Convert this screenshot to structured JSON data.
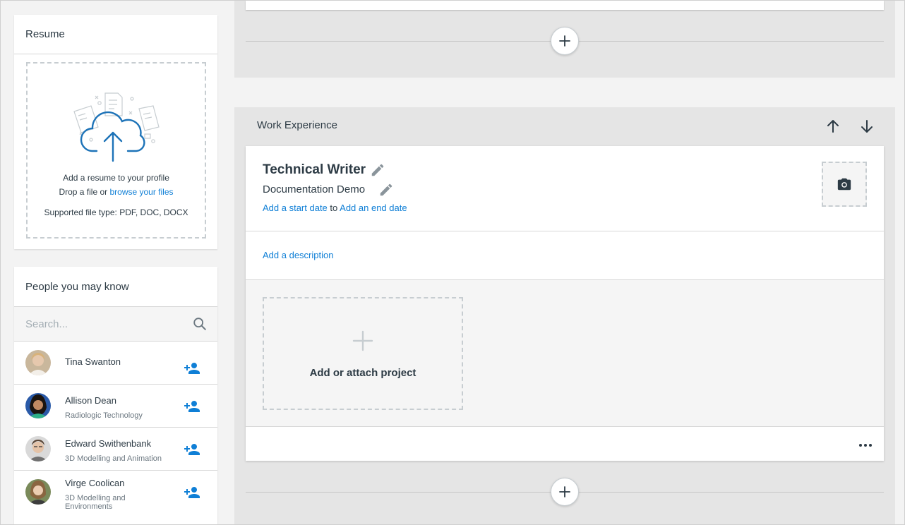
{
  "resume": {
    "title": "Resume",
    "line1": "Add a resume to your profile",
    "line2_prefix": "Drop a file or ",
    "line2_link": "browse your files",
    "line3": "Supported file type: PDF, DOC, DOCX"
  },
  "people": {
    "title": "People you may know",
    "search_placeholder": "Search...",
    "items": [
      {
        "name": "Tina Swanton",
        "desc": ""
      },
      {
        "name": "Allison Dean",
        "desc": "Radiologic Technology"
      },
      {
        "name": "Edward Swithenbank",
        "desc": "3D Modelling and Animation"
      },
      {
        "name": "Virge Coolican",
        "desc": "3D Modelling and Environments"
      }
    ]
  },
  "work": {
    "section_title": "Work Experience",
    "job_title": "Technical Writer",
    "company": "Documentation Demo",
    "start_date_link": "Add a start date",
    "to_word": "to",
    "end_date_link": "Add an end date",
    "description_link": "Add a description",
    "project_label": "Add or attach project"
  },
  "colors": {
    "accent": "#0f7fd6",
    "section_bg": "#e5e5e5",
    "text": "#2d3b45"
  },
  "icons": [
    "plus-icon",
    "search-icon",
    "add-person-icon",
    "arrow-up-icon",
    "arrow-down-icon",
    "pencil-icon",
    "camera-icon",
    "more-horizontal-icon",
    "cloud-upload-icon"
  ]
}
